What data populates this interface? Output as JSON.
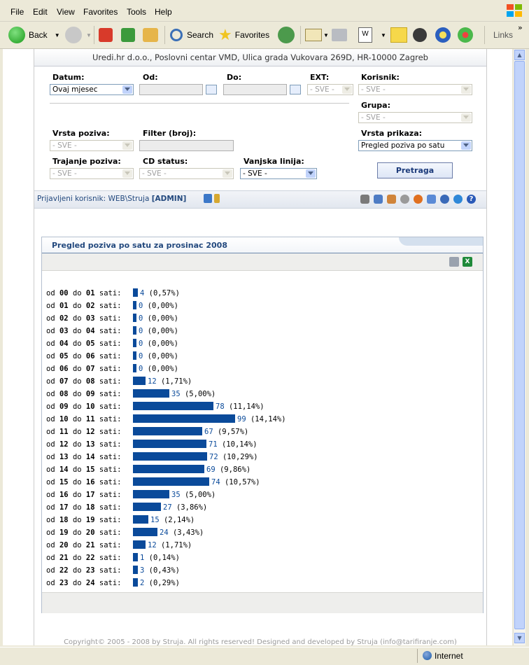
{
  "menu": [
    "File",
    "Edit",
    "View",
    "Favorites",
    "Tools",
    "Help"
  ],
  "toolbar": {
    "back": "Back",
    "search": "Search",
    "favorites": "Favorites",
    "links": "Links"
  },
  "header": {
    "company": "Uredi.hr d.o.o., Poslovni centar VMD, Ulica grada Vukovara 269D, HR-10000 Zagreb"
  },
  "filters": {
    "datum_label": "Datum:",
    "datum_value": "Ovaj mjesec",
    "od_label": "Od:",
    "do_label": "Do:",
    "ext_label": "EXT:",
    "ext_value": "- SVE -",
    "korisnik_label": "Korisnik:",
    "korisnik_value": "- SVE -",
    "grupa_label": "Grupa:",
    "grupa_value": "- SVE -",
    "vrsta_poziva_label": "Vrsta poziva:",
    "vrsta_poziva_value": "- SVE -",
    "filter_label": "Filter (broj):",
    "vrsta_prikaza_label": "Vrsta prikaza:",
    "vrsta_prikaza_value": "Pregled poziva po satu",
    "trajanje_label": "Trajanje poziva:",
    "trajanje_value": "- SVE -",
    "cd_label": "CD status:",
    "cd_value": "- SVE -",
    "vanjska_label": "Vanjska linija:",
    "vanjska_value": "- SVE -",
    "search_button": "Pretraga"
  },
  "userbar": {
    "prefix": "Prijavljeni korisnik: WEB\\Struja ",
    "role": "[ADMIN]"
  },
  "panel": {
    "title": "Pregled poziva po satu za prosinac 2008"
  },
  "chart_data": {
    "type": "bar",
    "title": "Pregled poziva po satu za prosinac 2008",
    "categories": [
      "00",
      "01",
      "02",
      "03",
      "04",
      "05",
      "06",
      "07",
      "08",
      "09",
      "10",
      "11",
      "12",
      "13",
      "14",
      "15",
      "16",
      "17",
      "18",
      "19",
      "20",
      "21",
      "22",
      "23"
    ],
    "values": [
      4,
      0,
      0,
      0,
      0,
      0,
      0,
      12,
      35,
      78,
      99,
      67,
      71,
      72,
      69,
      74,
      35,
      27,
      15,
      24,
      12,
      1,
      3,
      2
    ],
    "percents": [
      "0,57%",
      "0,00%",
      "0,00%",
      "0,00%",
      "0,00%",
      "0,00%",
      "0,00%",
      "1,71%",
      "5,00%",
      "11,14%",
      "14,14%",
      "9,57%",
      "10,14%",
      "10,29%",
      "9,86%",
      "10,57%",
      "5,00%",
      "3,86%",
      "2,14%",
      "3,43%",
      "1,71%",
      "0,14%",
      "0,43%",
      "0,29%"
    ],
    "row_prefix": "od",
    "row_mid": "do",
    "row_suffix": "sati:",
    "bar_color": "#0a4a9a"
  },
  "footer": {
    "copyright": "Copyright© 2005 - 2008 by Struja. All rights reserved! Designed and developed by Struja (info@tarifiranje.com)"
  },
  "status": {
    "zone": "Internet"
  }
}
